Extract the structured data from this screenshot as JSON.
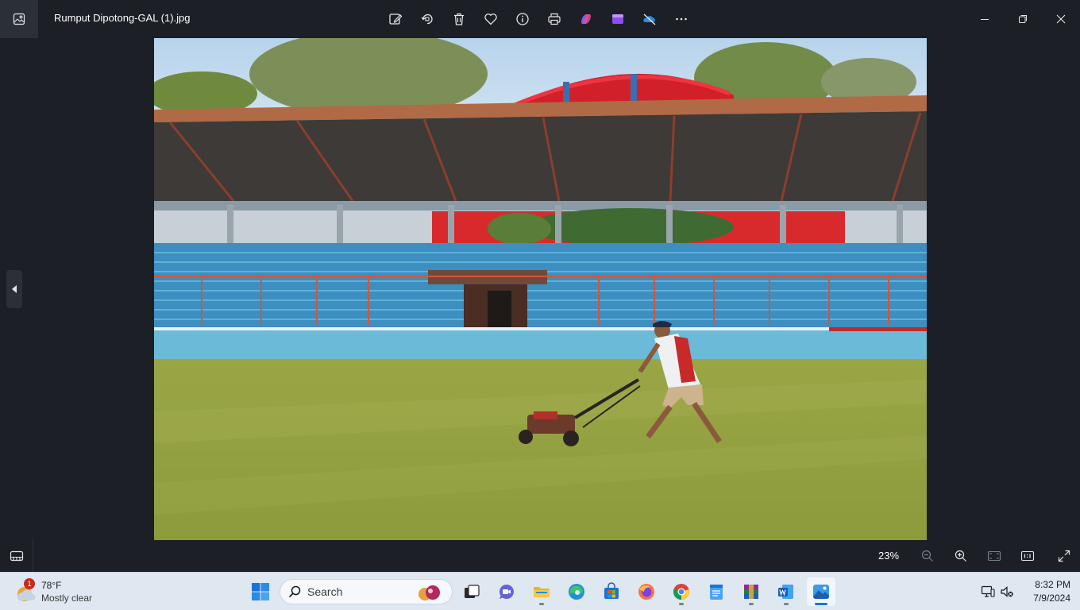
{
  "window": {
    "title": "Rumput Dipotong-GAL (1).jpg",
    "app_icon": "photos-gallery-icon"
  },
  "toolbar": {
    "items": [
      {
        "name": "edit-image-icon"
      },
      {
        "name": "rotate-icon"
      },
      {
        "name": "delete-icon"
      },
      {
        "name": "favorite-icon"
      },
      {
        "name": "info-icon"
      },
      {
        "name": "print-icon"
      },
      {
        "name": "copilot-icon"
      },
      {
        "name": "clipchamp-icon"
      },
      {
        "name": "onedrive-off-icon"
      },
      {
        "name": "more-icon"
      }
    ]
  },
  "viewer": {
    "image_alt": "Man pushing lawn mower on stadium grass field",
    "prev_icon": "chevron-left-icon"
  },
  "bottombar": {
    "zoom": "23%",
    "icons": [
      "filmstrip-icon",
      "zoom-out-icon",
      "zoom-in-icon",
      "fit-window-icon",
      "actual-size-icon",
      "fullscreen-icon"
    ]
  },
  "taskbar": {
    "weather": {
      "temp": "78°F",
      "condition": "Mostly clear",
      "badge": "1"
    },
    "search_placeholder": "Search",
    "clock": {
      "time": "8:32 PM",
      "date": "7/9/2024"
    },
    "colors": {
      "accent": "#1a73d9",
      "badge": "#c42b1c"
    }
  }
}
